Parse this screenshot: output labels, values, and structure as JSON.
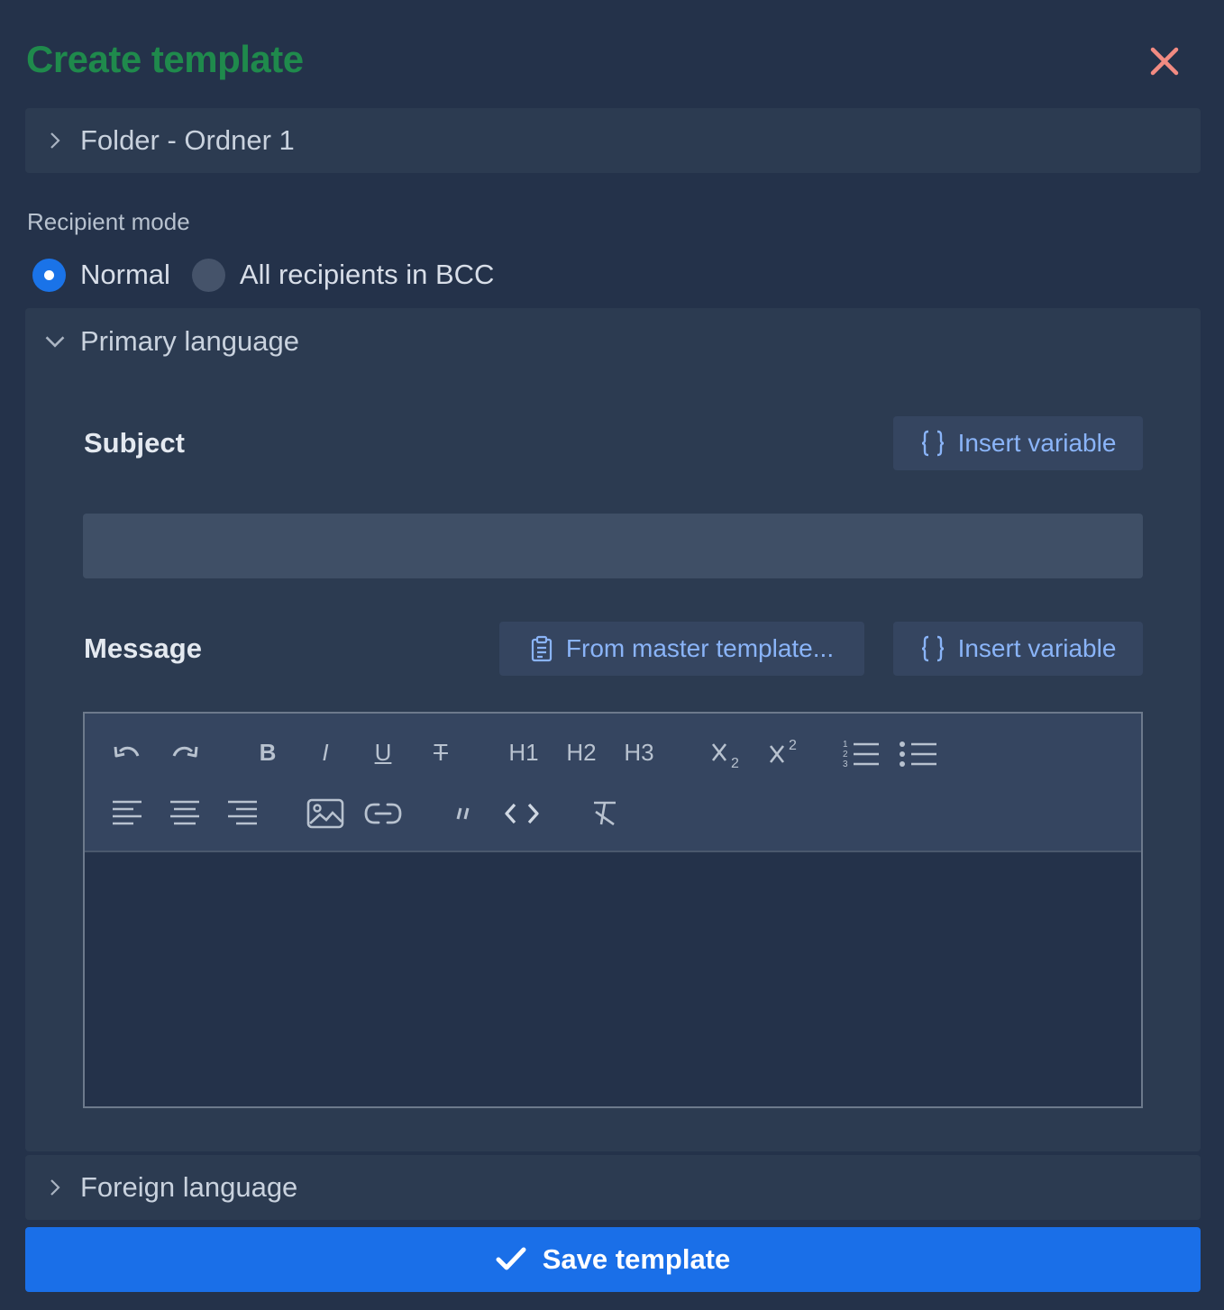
{
  "header": {
    "title": "Create template"
  },
  "folder": {
    "label": "Folder - Ordner 1"
  },
  "recipient_mode": {
    "label": "Recipient mode",
    "options": [
      "Normal",
      "All recipients in BCC"
    ],
    "selected": "Normal"
  },
  "primary_language": {
    "label": "Primary language",
    "subject": {
      "label": "Subject",
      "insert_variable": "Insert variable",
      "value": ""
    },
    "message": {
      "label": "Message",
      "from_master": "From master template...",
      "insert_variable": "Insert variable",
      "toolbar": {
        "h1": "H1",
        "h2": "H2",
        "h3": "H3",
        "bold": "B",
        "italic": "I",
        "underline": "U",
        "strike": "T"
      }
    }
  },
  "foreign_language": {
    "label": "Foreign language"
  },
  "footer": {
    "save_label": "Save template"
  },
  "colors": {
    "title": "#1f8a4c",
    "close": "#f28b82",
    "accent": "#1a6fe8",
    "link": "#8ab4f8"
  }
}
